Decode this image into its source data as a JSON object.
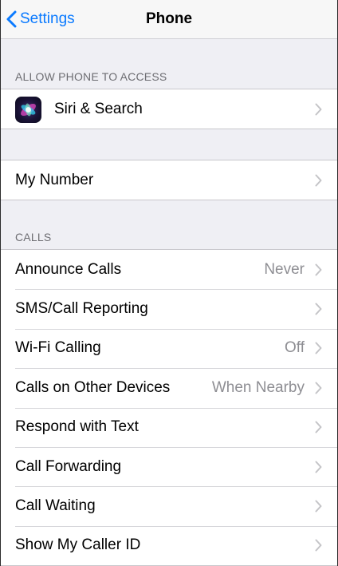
{
  "nav": {
    "back_label": "Settings",
    "title": "Phone"
  },
  "access": {
    "header": "ALLOW PHONE TO ACCESS",
    "siri_label": "Siri & Search"
  },
  "my_number": {
    "label": "My Number"
  },
  "calls": {
    "header": "CALLS",
    "rows": [
      {
        "label": "Announce Calls",
        "value": "Never"
      },
      {
        "label": "SMS/Call Reporting",
        "value": ""
      },
      {
        "label": "Wi-Fi Calling",
        "value": "Off"
      },
      {
        "label": "Calls on Other Devices",
        "value": "When Nearby"
      },
      {
        "label": "Respond with Text",
        "value": ""
      },
      {
        "label": "Call Forwarding",
        "value": ""
      },
      {
        "label": "Call Waiting",
        "value": ""
      },
      {
        "label": "Show My Caller ID",
        "value": ""
      }
    ]
  },
  "colors": {
    "accent": "#0a7aff",
    "background": "#efeff4",
    "secondary_text": "#8e8e93",
    "section_header": "#6d6d72"
  },
  "icons": {
    "back": "chevron-left-icon",
    "disclosure": "chevron-right-icon",
    "siri": "siri-icon"
  }
}
